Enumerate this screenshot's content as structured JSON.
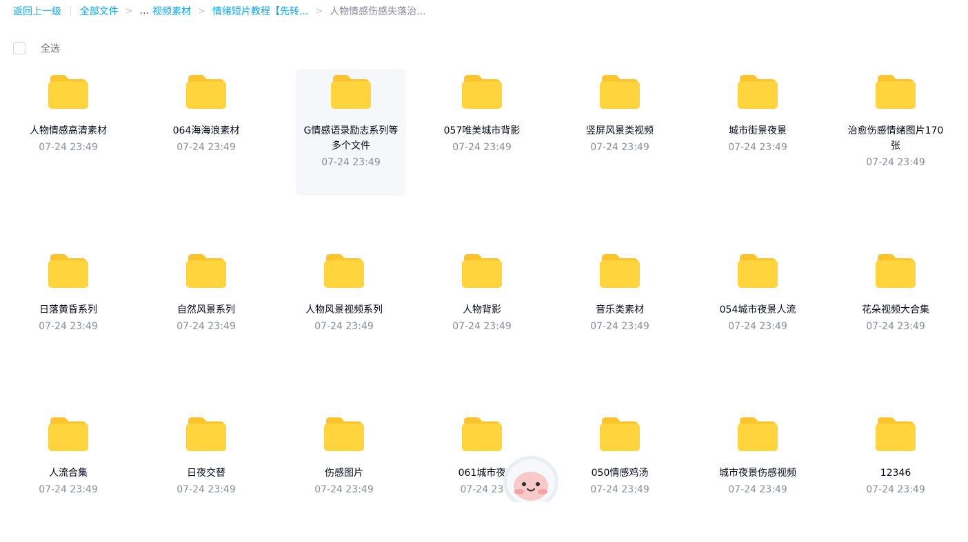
{
  "breadcrumb": {
    "back": "返回上一级",
    "all_files": "全部文件",
    "ellipsis": "...",
    "video_assets": "视频素材",
    "tutorial": "情绪短片教程【先转...",
    "current": "人物情感伤感失落治..."
  },
  "select_all": {
    "label": "全选"
  },
  "folders": [
    {
      "name": "人物情感高清素材",
      "date": "07-24 23:49"
    },
    {
      "name": "064海海浪素材",
      "date": "07-24 23:49"
    },
    {
      "name": "G情感语录励志系列等多个文件",
      "date": "07-24 23:49"
    },
    {
      "name": "057唯美城市背影",
      "date": "07-24 23:49"
    },
    {
      "name": "竖屏风景类视频",
      "date": "07-24 23:49"
    },
    {
      "name": "城市街景夜景",
      "date": "07-24 23:49"
    },
    {
      "name": "治愈伤感情绪图片170张",
      "date": "07-24 23:49"
    },
    {
      "name": "日落黄昏系列",
      "date": "07-24 23:49"
    },
    {
      "name": "自然风景系列",
      "date": "07-24 23:49"
    },
    {
      "name": "人物风景视频系列",
      "date": "07-24 23:49"
    },
    {
      "name": "人物背影",
      "date": "07-24 23:49"
    },
    {
      "name": "音乐类素材",
      "date": "07-24 23:49"
    },
    {
      "name": "054城市夜景人流",
      "date": "07-24 23:49"
    },
    {
      "name": "花朵视频大合集",
      "date": "07-24 23:49"
    },
    {
      "name": "人流合集",
      "date": "07-24 23:49"
    },
    {
      "name": "日夜交替",
      "date": "07-24 23:49"
    },
    {
      "name": "伤感图片",
      "date": "07-24 23:49"
    },
    {
      "name": "061城市夜",
      "date": "07-24 23"
    },
    {
      "name": "050情感鸡汤",
      "date": "07-24 23:49"
    },
    {
      "name": "城市夜景伤感视频",
      "date": "07-24 23:49"
    },
    {
      "name": "12346",
      "date": "07-24 23:49"
    }
  ],
  "icons": {
    "folder": "folder-icon",
    "mascot": "assistant-mascot-icon"
  },
  "colors": {
    "link": "#06a7ff",
    "folder_body": "#ffd43d",
    "folder_back": "#ffc42c"
  }
}
